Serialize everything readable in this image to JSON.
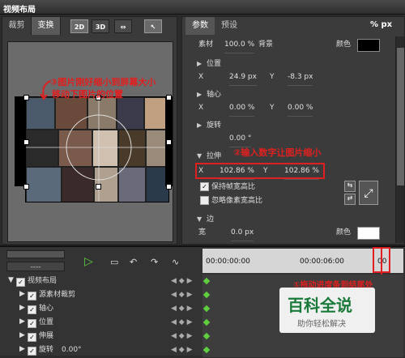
{
  "window": {
    "title": "视频布局"
  },
  "left": {
    "tabs": [
      "裁剪",
      "变换"
    ],
    "tools": [
      "2D",
      "3D",
      "⇔",
      "↖"
    ]
  },
  "right": {
    "tabs": [
      "参数",
      "预设"
    ],
    "px_label": "% px",
    "material": {
      "label": "素材",
      "value": "100.0 %",
      "bg_label": "背景",
      "color_label": "颜色"
    },
    "position": {
      "label": "位置",
      "x_label": "X",
      "x_value": "24.9 px",
      "y_label": "Y",
      "y_value": "-8.3 px"
    },
    "axis": {
      "label": "轴心",
      "x_label": "X",
      "x_value": "0.00 %",
      "y_label": "Y",
      "y_value": "0.00 %"
    },
    "rotate": {
      "label": "旋转",
      "value": "0.00 °"
    },
    "stretch": {
      "label": "拉伸",
      "x_label": "X",
      "x_value": "102.86 %",
      "y_label": "Y",
      "y_value": "102.86 %"
    },
    "keep_ratio": {
      "label": "保持帧宽高比",
      "checked": true
    },
    "ignore_pixel": {
      "label": "忽略像素宽高比",
      "checked": false
    },
    "border": {
      "label": "边",
      "width_label": "宽",
      "width_value": "0.0 px",
      "color_label": "颜色"
    }
  },
  "annotations": {
    "a1": "③图片刚好缩小到屏幕大小",
    "a2": "移动下图片的位置",
    "a3": "②输入数字让图片缩小",
    "a4": "①拖动进度条到结尾处"
  },
  "timeline": {
    "time_left": "00:00:00:00",
    "time_mid": "00:00:06:00",
    "time_end": "00",
    "dropdown": "----",
    "rows": [
      {
        "label": "视频布局",
        "indent": 0
      },
      {
        "label": "源素材裁剪",
        "indent": 1
      },
      {
        "label": "轴心",
        "indent": 1
      },
      {
        "label": "位置",
        "indent": 1
      },
      {
        "label": "伸展",
        "indent": 1
      },
      {
        "label": "旋转",
        "indent": 1,
        "value": "0.00°"
      }
    ]
  },
  "watermark": {
    "title": "百科全说",
    "subtitle": "助你轻松解决"
  },
  "colors": {
    "annotation": "#e02020",
    "keyframe": "#5fcf3f"
  }
}
